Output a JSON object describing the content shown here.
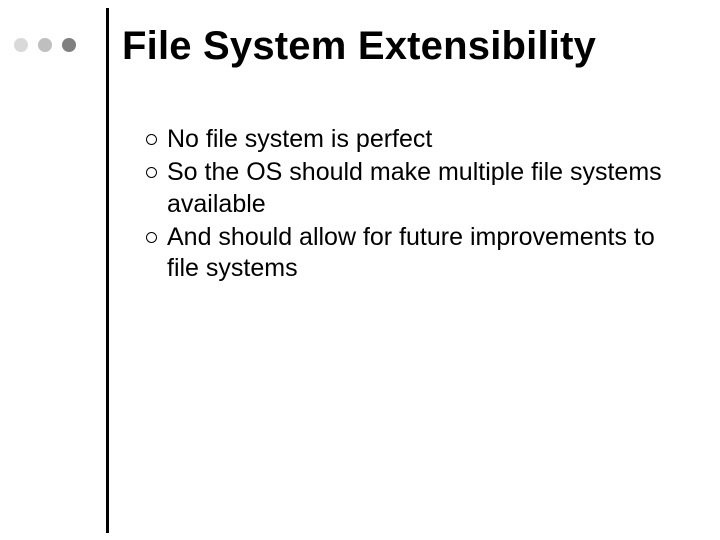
{
  "slide": {
    "title": "File System Extensibility",
    "bullets": [
      "No file system is perfect",
      "So the OS should make multiple file systems available",
      "And should allow for future improvements to file systems"
    ]
  }
}
